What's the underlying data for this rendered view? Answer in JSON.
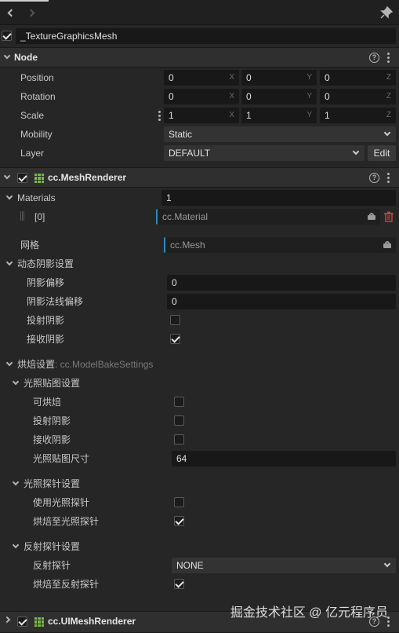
{
  "node_name": "_TextureGraphicsMesh",
  "node_section": {
    "title": "Node",
    "position": {
      "label": "Position",
      "x": "0",
      "y": "0",
      "z": "0"
    },
    "rotation": {
      "label": "Rotation",
      "x": "0",
      "y": "0",
      "z": "0"
    },
    "scale": {
      "label": "Scale",
      "x": "1",
      "y": "1",
      "z": "1"
    },
    "mobility": {
      "label": "Mobility",
      "value": "Static"
    },
    "layer": {
      "label": "Layer",
      "value": "DEFAULT",
      "edit_label": "Edit"
    },
    "axis_x": "X",
    "axis_y": "Y",
    "axis_z": "Z"
  },
  "mesh_renderer": {
    "title": "cc.MeshRenderer",
    "materials_label": "Materials",
    "materials_count": "1",
    "material_index": "[0]",
    "material_value": "cc.Material",
    "mesh_label": "网格",
    "mesh_value": "cc.Mesh",
    "dynamic_shadow": {
      "title": "动态阴影设置",
      "shadow_bias_label": "阴影偏移",
      "shadow_bias": "0",
      "shadow_normal_bias_label": "阴影法线偏移",
      "shadow_normal_bias": "0",
      "cast_shadow_label": "投射阴影",
      "receive_shadow_label": "接收阴影"
    },
    "bake_settings": {
      "title": "烘焙设置",
      "type": ": cc.ModelBakeSettings",
      "lightmap": {
        "title": "光照贴图设置",
        "bakeable_label": "可烘焙",
        "cast_shadow_label": "投射阴影",
        "receive_shadow_label": "接收阴影",
        "size_label": "光照贴图尺寸",
        "size_value": "64"
      },
      "light_probe": {
        "title": "光照探针设置",
        "use_label": "使用光照探针",
        "bake_to_label": "烘焙至光照探针"
      },
      "reflection_probe": {
        "title": "反射探针设置",
        "probe_label": "反射探针",
        "probe_value": "NONE",
        "bake_to_label": "烘焙至反射探针"
      }
    }
  },
  "ui_mesh_renderer": {
    "title": "cc.UIMeshRenderer"
  },
  "watermark": "掘金技术社区 @ 亿元程序员"
}
